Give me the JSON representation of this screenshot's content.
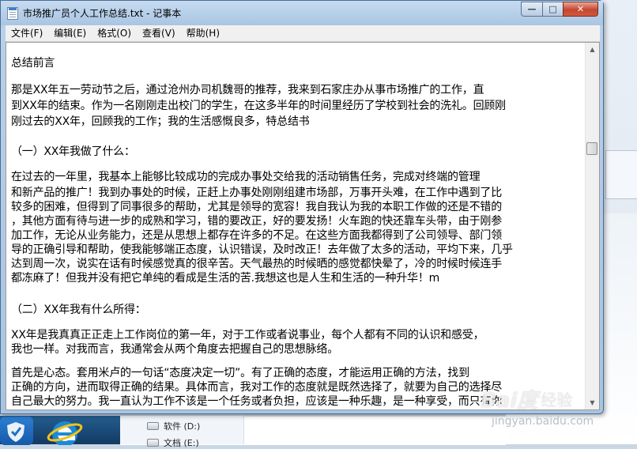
{
  "window": {
    "title": "市场推广员个人工作总结.txt - 记事本",
    "minimize_glyph": "—",
    "maximize_glyph": "□",
    "close_glyph": "✕"
  },
  "menu": [
    {
      "label": "文件(F)"
    },
    {
      "label": "编辑(E)"
    },
    {
      "label": "格式(O)"
    },
    {
      "label": "查看(V)"
    },
    {
      "label": "帮助(H)"
    }
  ],
  "document": {
    "lines": [
      "    总结前言",
      "    那是XX年五一劳动节之后，通过沧州办司机魏哥的推荐，我来到石家庄办从事市场推广的工作，直",
      "到XX年的结束。作为一名刚刚走出校门的学生，在这多半年的时间里经历了学校到社会的洗礼。回顾刚",
      "刚过去的XX年，回顾我的工作；我的生活感慨良多，特总结书",
      "    （一）XX年我做了什么：",
      "    在过去的一年里，我基本上能够比较成功的完成办事处交给我的活动销售任务，完成对终端的管理",
      "和新产品的推广！我到办事处的时候，正赶上办事处刚刚组建市场部，万事开头难，在工作中遇到了比",
      "较多的困难，但得到了同事很多的帮助，尤其是领导的宽容！我自我认为我的本职工作做的还是不错的",
      "，其他方面有待与进一步的成熟和学习，错的要改正，好的要发扬！火车跑的快还靠车头带，由于刚参",
      "加工作，无论从业务能力，还是从思想上都存在许多的不足。在这些方面我都得到了公司领导、部门领",
      "导的正确引导和帮助，使我能够端正态度，认识错误，及时改正！去年做了太多的活动，平均下来，几乎",
      "达到周一次，说实在话有时候感觉真的很辛苦。天气最热的时候晒的感觉都快晕了，冷的时候时候连手",
      "都冻麻了！但我并没有把它单纯的看成是生活的苦.我想这也是人生和生活的一种升华！m",
      "    （二）XX年我有什么所得：",
      "    XX年是我真真正正走上工作岗位的第一年，对于工作或者说事业，每个人都有不同的认识和感受，",
      "我也一样。对我而言，我通常会从两个角度去把握自己的思想脉络。",
      "    首先是心态。套用米卢的一句话“态度决定一切”。有了正确的态度，才能运用正确的方法，找到",
      "正确的方向，进而取得正确的结果。具体而言，我对工作的态度就是既然选择了，就要为自己的选择尽",
      "自己最大的努力。我一直认为工作不该是一个任务或者负担，应该是一种乐趣，是一种享受，而只有你"
    ]
  },
  "background": {
    "drives": [
      {
        "label": "软件 (D:)"
      },
      {
        "label": "文档 (E:)"
      }
    ]
  },
  "watermark": {
    "logo": "Bai度",
    "suffix": "经验",
    "url": "jingyan.baidu.com"
  }
}
